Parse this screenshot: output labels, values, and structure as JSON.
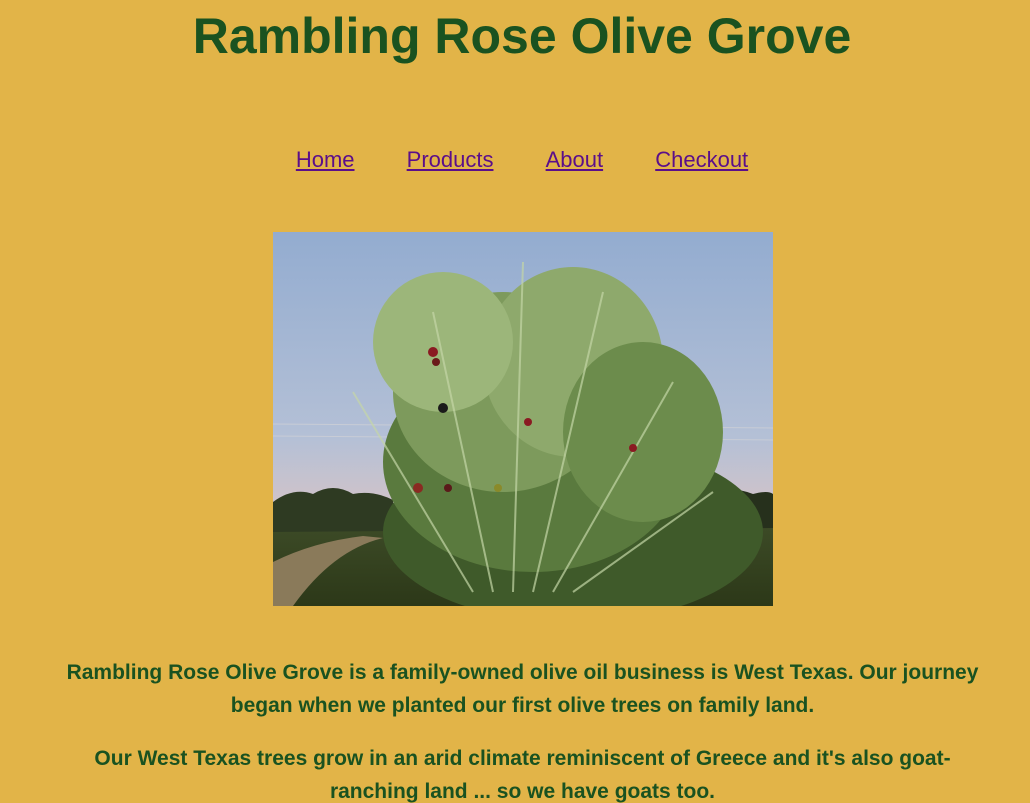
{
  "header": {
    "title": "Rambling Rose Olive Grove"
  },
  "nav": {
    "items": [
      {
        "label": "Home"
      },
      {
        "label": "Products"
      },
      {
        "label": "About"
      },
      {
        "label": "Checkout"
      }
    ]
  },
  "hero": {
    "alt": "Olive tree branch with olives"
  },
  "main": {
    "paragraphs": [
      "Rambling Rose Olive Grove is a family-owned olive oil business is West Texas. Our journey began when we planted our first olive trees on family land.",
      "Our West Texas trees grow in an arid climate reminiscent of Greece and it's also goat-ranching land ... so we have goats too."
    ]
  },
  "colors": {
    "background": "#e2b448",
    "heading": "#1a5220",
    "link": "#5b0e8a"
  }
}
